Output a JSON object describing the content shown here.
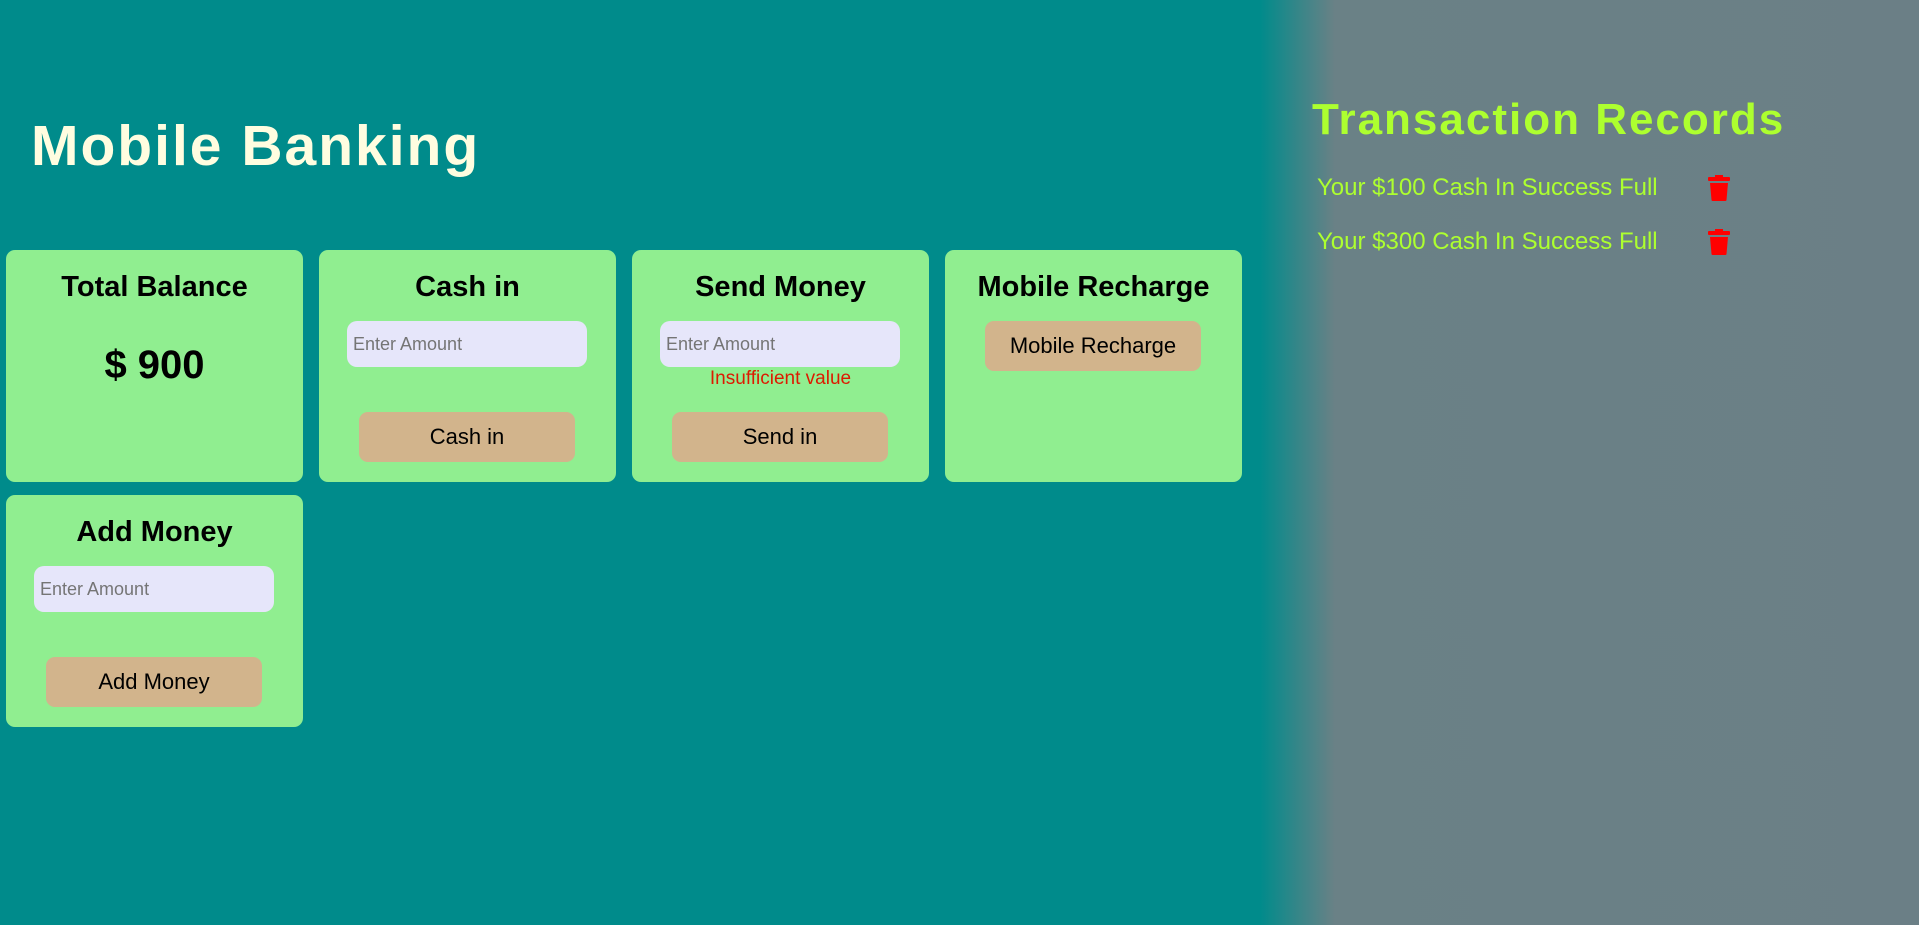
{
  "app_title": "Mobile Banking",
  "cards": {
    "balance": {
      "title": "Total Balance",
      "value": "$ 900"
    },
    "cash_in": {
      "title": "Cash in",
      "placeholder": "Enter Amount",
      "button": "Cash in"
    },
    "send_money": {
      "title": "Send Money",
      "placeholder": "Enter Amount",
      "error": "Insufficient value",
      "button": "Send in"
    },
    "mobile_recharge": {
      "title": "Mobile Recharge",
      "button": "Mobile Recharge"
    },
    "add_money": {
      "title": "Add Money",
      "placeholder": "Enter Amount",
      "button": "Add Money"
    }
  },
  "records": {
    "title": "Transaction Records",
    "items": [
      {
        "text": "Your $100 Cash In Success Full",
        "icon": "trash-icon"
      },
      {
        "text": "Your $300 Cash In Success Full",
        "icon": "trash-icon"
      }
    ]
  },
  "colors": {
    "background": "#008b8b",
    "sidebar_background": "#6b7f86",
    "card": "#90ee90",
    "button": "#d2b48c",
    "input": "#e6e6fa",
    "title": "#fffde0",
    "records_text": "#adff2f",
    "error": "#dd1a00",
    "delete_icon": "#ff0000"
  }
}
